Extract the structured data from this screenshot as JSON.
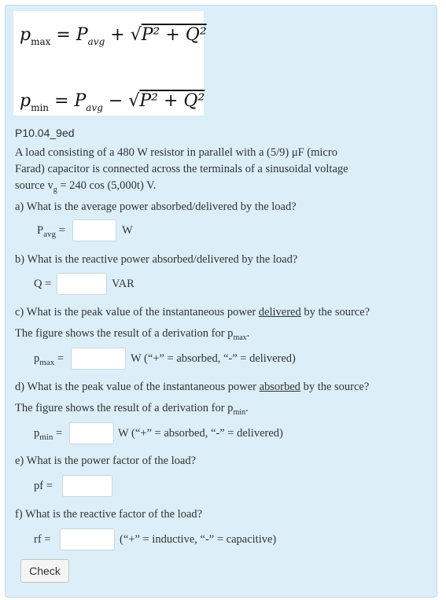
{
  "formulas": {
    "pmax": {
      "lhs": "p",
      "lhs_sub": "max",
      "rhs": "= P",
      "rhs_sub": "avg",
      "op": "+",
      "root": "P² + Q²"
    },
    "pmin": {
      "lhs": "p",
      "lhs_sub": "min",
      "rhs": "= P",
      "rhs_sub": "avg",
      "op": "−",
      "root": "P² + Q²"
    }
  },
  "problem_id": "P10.04_9ed",
  "intro": {
    "line1": "A load consisting of a 480 W resistor in parallel with a (5/9) μF (micro",
    "line2": "Farad) capacitor is connected across the terminals of a sinusoidal voltage",
    "line3_pre": "source v",
    "line3_sub": "g",
    "line3_post": " = 240 cos (5,000t) V."
  },
  "parts": {
    "a": {
      "question": "a) What is the average power absorbed/delivered by the load?",
      "label": "P",
      "label_sub": "avg",
      "eq": "=",
      "value": "",
      "unit": "W"
    },
    "b": {
      "question": "b) What is the reactive power absorbed/delivered by the load?",
      "label": "Q",
      "eq": "=",
      "value": "",
      "unit": "VAR"
    },
    "c": {
      "question_pre": "c) What is the peak value of the instantaneous power ",
      "question_u": "delivered",
      "question_post": " by the source?",
      "note_pre": "The figure shows the result of a derivation for p",
      "note_sub": "max",
      "note_post": ".",
      "label": "p",
      "label_sub": "max",
      "eq": "=",
      "value": "",
      "unit": "W  (“+” = absorbed, “-” = delivered)"
    },
    "d": {
      "question_pre": "d) What is the peak value of the instantaneous power ",
      "question_u": "absorbed",
      "question_post": " by the source?",
      "note_pre": "The figure shows the result of a derivation for p",
      "note_sub": "min",
      "note_post": ".",
      "label": "p",
      "label_sub": "min",
      "eq": "=",
      "value": "",
      "unit": "W (“+” = absorbed, “-” = delivered)"
    },
    "e": {
      "question": "e) What is the power factor of the load?",
      "label": "pf",
      "eq": "=",
      "value": ""
    },
    "f": {
      "question": "f) What is the reactive factor of the load?",
      "label": "rf",
      "eq": "=",
      "value": "",
      "unit": "(“+” = inductive, “-” = capacitive)"
    }
  },
  "check_button": "Check"
}
